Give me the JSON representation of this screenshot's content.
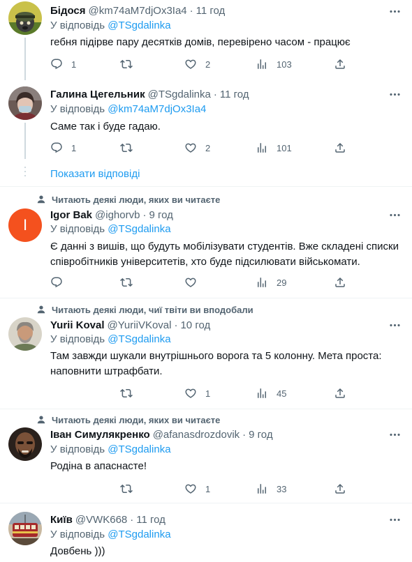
{
  "reply_prefix": "У відповідь",
  "show_replies": "Показати відповіді",
  "tweets": [
    {
      "name": "Бідося",
      "handle": "@km74aM7djOx3Ia4",
      "time": "11 год",
      "reply_to": "@TSgdalinka",
      "text": "гебня підірве пару десятків домів, перевірено часом - працює",
      "replies": "1",
      "retweets": "",
      "likes": "2",
      "views": "103"
    },
    {
      "name": "Галина Цегельник",
      "handle": "@TSgdalinka",
      "time": "11 год",
      "reply_to": "@km74aM7djOx3Ia4",
      "text": "Саме так і буде гадаю.",
      "replies": "1",
      "retweets": "",
      "likes": "2",
      "views": "101"
    },
    {
      "social": "Читають деякі люди, яких ви читаєте",
      "avatar_letter": "I",
      "name": "Igor Bak",
      "handle": "@ighorvb",
      "time": "9 год",
      "reply_to": "@TSgdalinka",
      "text": "Є данні з вишів, що будуть мобілізувати студентів. Вже складені списки співробітників університетів, хто буде підсилювати військомати.",
      "replies": "",
      "retweets": "",
      "likes": "",
      "views": "29"
    },
    {
      "social": "Читають деякі люди, чиї твіти ви вподобали",
      "name": "Yurii Koval",
      "handle": "@YuriiVKoval",
      "time": "10 год",
      "reply_to": "@TSgdalinka",
      "text": "Там завжди шукали внутрішнього ворога та 5 колонну. Мета проста: наповнити штрафбати.",
      "replies": "",
      "retweets": "",
      "likes": "1",
      "views": "45"
    },
    {
      "social": "Читають деякі люди, яких ви читаєте",
      "name": "Іван Симулякренко",
      "handle": "@afanasdrozdovik",
      "time": "9 год",
      "reply_to": "@TSgdalinka",
      "text": "Родіна в апаснасте!",
      "replies": "",
      "retweets": "",
      "likes": "1",
      "views": "33"
    },
    {
      "name": "Київ",
      "handle": "@VWK668",
      "time": "11 год",
      "reply_to": "@TSgdalinka",
      "text": "Довбень )))"
    }
  ],
  "colors": {
    "link": "#1d9bf0",
    "secondary_text": "#536471",
    "primary_text": "#0f1419",
    "igor_avatar": "#f4511e"
  }
}
